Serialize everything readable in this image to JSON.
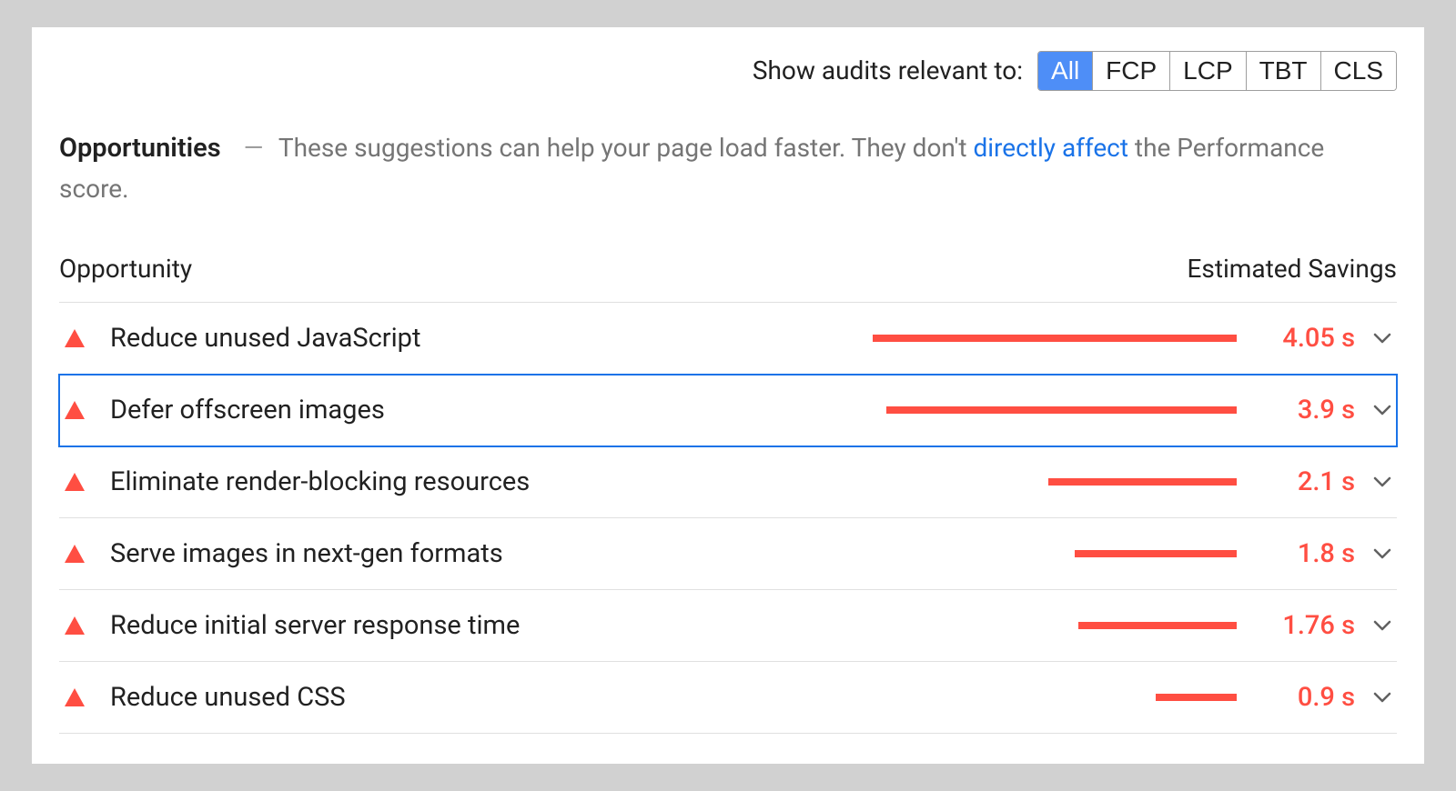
{
  "filter": {
    "label": "Show audits relevant to:",
    "options": [
      "All",
      "FCP",
      "LCP",
      "TBT",
      "CLS"
    ],
    "active": "All"
  },
  "section": {
    "title": "Opportunities",
    "dash": "—",
    "desc_before": "These suggestions can help your page load faster. They don't ",
    "desc_link": "directly affect",
    "desc_after": " the Performance score."
  },
  "table": {
    "col_opportunity": "Opportunity",
    "col_savings": "Estimated Savings"
  },
  "colors": {
    "fail": "#ff4e42",
    "link": "#1a73e8"
  },
  "max_savings_seconds": 4.05,
  "opportunities": [
    {
      "label": "Reduce unused JavaScript",
      "savings_seconds": 4.05,
      "savings_text": "4.05 s",
      "selected": false
    },
    {
      "label": "Defer offscreen images",
      "savings_seconds": 3.9,
      "savings_text": "3.9 s",
      "selected": true
    },
    {
      "label": "Eliminate render-blocking resources",
      "savings_seconds": 2.1,
      "savings_text": "2.1 s",
      "selected": false
    },
    {
      "label": "Serve images in next-gen formats",
      "savings_seconds": 1.8,
      "savings_text": "1.8 s",
      "selected": false
    },
    {
      "label": "Reduce initial server response time",
      "savings_seconds": 1.76,
      "savings_text": "1.76 s",
      "selected": false
    },
    {
      "label": "Reduce unused CSS",
      "savings_seconds": 0.9,
      "savings_text": "0.9 s",
      "selected": false
    }
  ]
}
